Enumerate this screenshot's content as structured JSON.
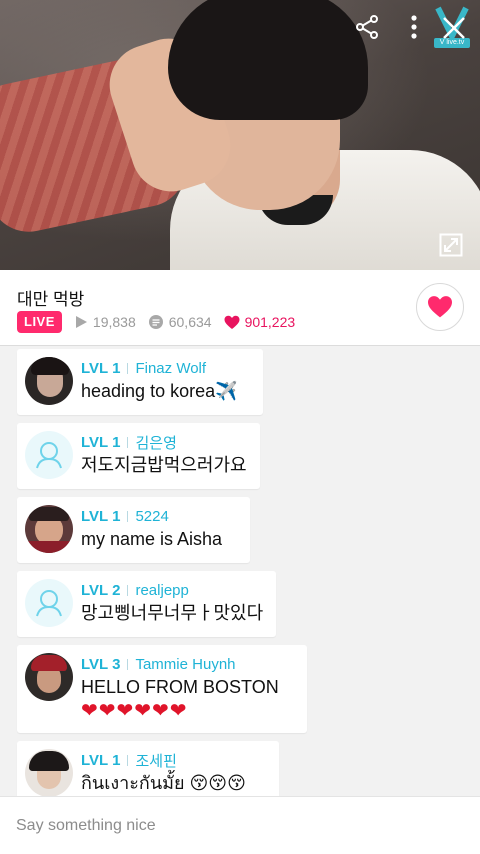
{
  "broadcast": {
    "title": "대만 먹방",
    "live_label": "LIVE",
    "views": "19,838",
    "comments": "60,634",
    "likes": "901,223"
  },
  "video": {
    "logo_text": "V live.tv"
  },
  "icons": {
    "share": "share-icon",
    "more": "more-vertical-icon",
    "close": "close-icon",
    "expand": "expand-icon",
    "play": "play-icon",
    "comment": "comment-bubble-icon",
    "heart": "heart-icon"
  },
  "colors": {
    "accent_pink": "#ff2a6d",
    "level_blue": "#1fb3d6",
    "heart_red": "#e0142a"
  },
  "messages": [
    {
      "level": "LVL 1",
      "user": "Finaz Wolf",
      "text": "heading to korea✈️",
      "avatar": "photo"
    },
    {
      "level": "LVL 1",
      "user": "김은영",
      "text": "저도지금밥먹으러가요",
      "avatar": "default"
    },
    {
      "level": "LVL 1",
      "user": "5224",
      "text": "my name is Aisha",
      "avatar": "photo"
    },
    {
      "level": "LVL 2",
      "user": "realjepp",
      "text": "망고삥너무너무ㅏ맛있다",
      "avatar": "default"
    },
    {
      "level": "LVL 3",
      "user": "Tammie Huynh",
      "text": "HELLO FROM BOSTON",
      "text2": "❤❤❤❤❤❤",
      "avatar": "photo"
    },
    {
      "level": "LVL 1",
      "user": "조세핀",
      "text": "กินเงาะกันมั้ย 😚😚😚",
      "avatar": "photo"
    }
  ],
  "composer": {
    "placeholder": "Say something nice"
  }
}
